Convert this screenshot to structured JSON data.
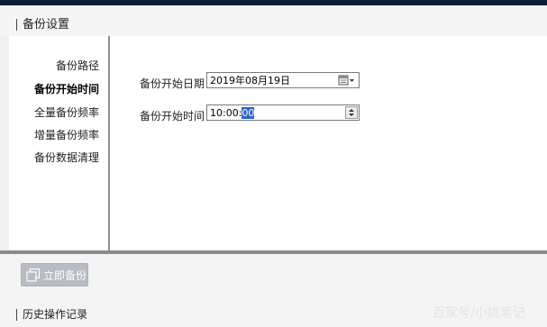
{
  "header": {
    "title": "备份设置"
  },
  "sidebar": {
    "items": [
      {
        "label": "备份路径",
        "active": false
      },
      {
        "label": "备份开始时间",
        "active": true
      },
      {
        "label": "全量备份频率",
        "active": false
      },
      {
        "label": "增量备份频率",
        "active": false
      },
      {
        "label": "备份数据清理",
        "active": false
      }
    ]
  },
  "form": {
    "start_date": {
      "label": "备份开始日期",
      "value": "2019年08月19日",
      "icon": "calendar-icon"
    },
    "start_time": {
      "label": "备份开始时间",
      "value_prefix": "10:00:",
      "value_selected": "00",
      "icon": "spinner-icon"
    }
  },
  "actions": {
    "backup_now": "立即备份",
    "backup_now_icon": "copy-icon"
  },
  "footer": {
    "history": "历史操作记录"
  },
  "watermark": "百家号/小姚笔记",
  "colors": {
    "top_bar": "#0b1f3a",
    "button_bg": "#b8bcc3",
    "selection": "#3062c8"
  }
}
